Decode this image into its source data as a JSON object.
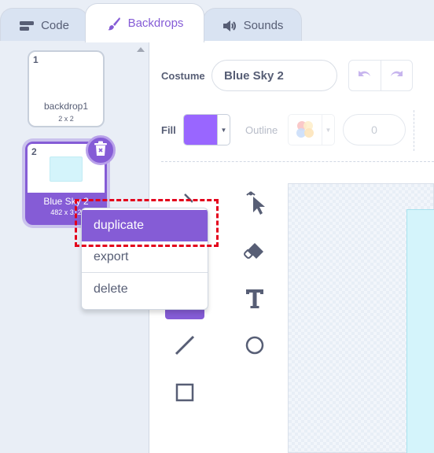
{
  "tabs": [
    {
      "label": "Code",
      "icon": "code-blocks-icon"
    },
    {
      "label": "Backdrops",
      "icon": "paintbrush-icon",
      "active": true
    },
    {
      "label": "Sounds",
      "icon": "speaker-icon"
    }
  ],
  "backdrops": [
    {
      "number": "1",
      "name": "backdrop1",
      "size": "2 x 2"
    },
    {
      "number": "2",
      "name": "Blue Sky 2",
      "size": "482 x 312",
      "selected": true
    }
  ],
  "context_menu": {
    "items": [
      "duplicate",
      "export",
      "delete"
    ],
    "highlighted": "duplicate"
  },
  "editor": {
    "costume_label": "Costume",
    "costume_name": "Blue Sky 2",
    "fill_label": "Fill",
    "fill_color": "#9966ff",
    "outline_label": "Outline",
    "outline_width": "0",
    "tools": [
      "reshape-icon",
      "eraser-icon",
      "text-icon",
      "line-icon",
      "circle-icon",
      "rectangle-icon"
    ]
  },
  "colors": {
    "accent": "#855cd6",
    "highlight_box": "#e3001b",
    "backdrop_thumb": "#d4f4fb"
  }
}
